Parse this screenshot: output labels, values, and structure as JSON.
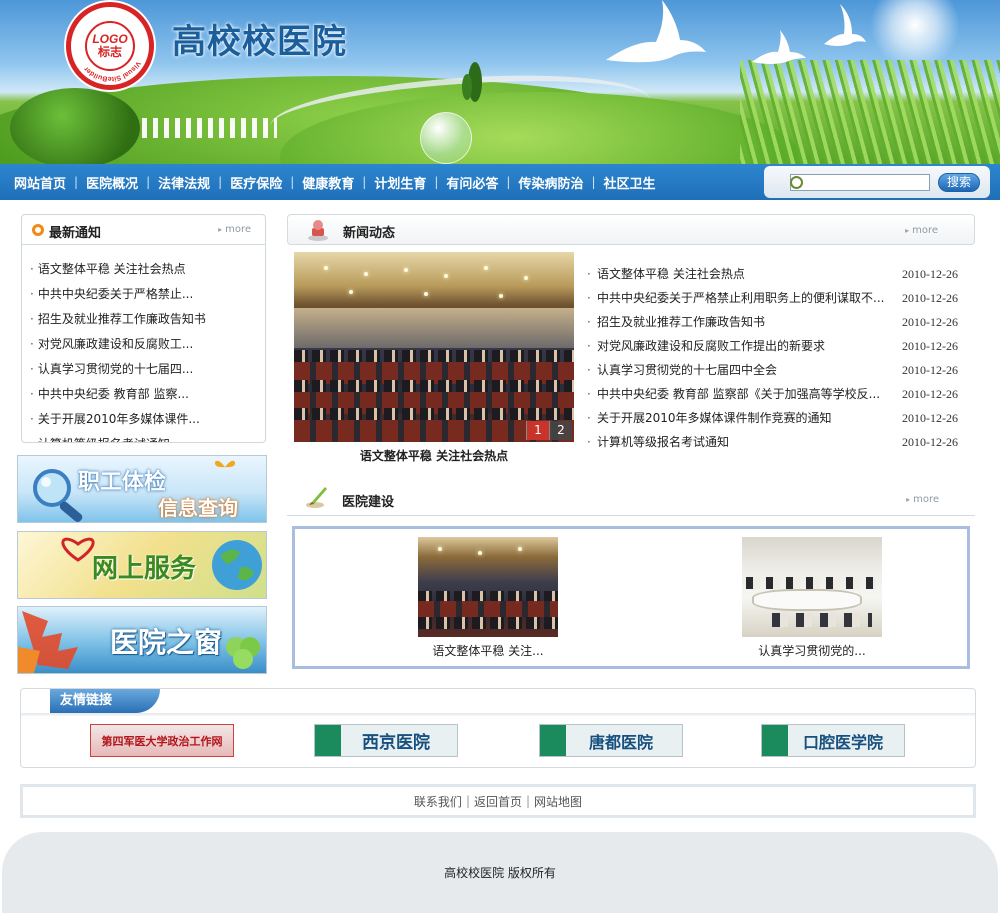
{
  "header": {
    "site_title": "高校校医院",
    "logo": {
      "center_top": "LOGO",
      "center_bottom": "标志",
      "ring_text": "Visual SiteBuilder"
    }
  },
  "nav": {
    "items": [
      "网站首页",
      "医院概况",
      "法律法规",
      "医疗保险",
      "健康教育",
      "计划生育",
      "有问必答",
      "传染病防治",
      "社区卫生"
    ],
    "separator": "|"
  },
  "search": {
    "input_value": "",
    "button_label": "搜索"
  },
  "notice": {
    "title": "最新通知",
    "more": "more",
    "items": [
      "语文整体平稳 关注社会热点",
      "中共中央纪委关于严格禁止...",
      "招生及就业推荐工作廉政告知书",
      "对党风廉政建设和反腐败工...",
      "认真学习贯彻党的十七届四...",
      "中共中央纪委 教育部 监察...",
      "关于开展2010年多媒体课件...",
      "计算机等级报名考试通知"
    ]
  },
  "promos": {
    "checkup": {
      "line1": "职工体检",
      "line2": "信息查询"
    },
    "online": {
      "label": "网上服务"
    },
    "window": {
      "label": "医院之窗"
    }
  },
  "news": {
    "title": "新闻动态",
    "more": "more",
    "photo_caption": "语文整体平稳 关注社会热点",
    "pager": [
      "1",
      "2"
    ],
    "items": [
      {
        "title": "语文整体平稳 关注社会热点",
        "date": "2010-12-26"
      },
      {
        "title": "中共中央纪委关于严格禁止利用职务上的便利谋取不...",
        "date": "2010-12-26"
      },
      {
        "title": "招生及就业推荐工作廉政告知书",
        "date": "2010-12-26"
      },
      {
        "title": "对党风廉政建设和反腐败工作提出的新要求",
        "date": "2010-12-26"
      },
      {
        "title": "认真学习贯彻党的十七届四中全会",
        "date": "2010-12-26"
      },
      {
        "title": "中共中央纪委 教育部 监察部《关于加强高等学校反...",
        "date": "2010-12-26"
      },
      {
        "title": "关于开展2010年多媒体课件制作竞赛的通知",
        "date": "2010-12-26"
      },
      {
        "title": "计算机等级报名考试通知",
        "date": "2010-12-26"
      }
    ]
  },
  "build": {
    "title": "医院建设",
    "more": "more",
    "items": [
      {
        "caption": "语文整体平稳 关注..."
      },
      {
        "caption": "认真学习贯彻党的..."
      }
    ]
  },
  "links": {
    "title": "友情链接",
    "items": [
      {
        "label": "第四军医大学政治工作网"
      },
      {
        "label": "西京医院"
      },
      {
        "label": "唐都医院"
      },
      {
        "label": "口腔医学院"
      }
    ]
  },
  "footer": {
    "links": [
      "联系我们",
      "返回首页",
      "网站地图"
    ],
    "separator": "|",
    "copyright": "高校校医院 版权所有"
  },
  "colors": {
    "nav_bg": "#1f6fb8",
    "accent_orange": "#f08a14",
    "link_tab": "#2a6fb6",
    "pager_active": "#c8342a"
  }
}
